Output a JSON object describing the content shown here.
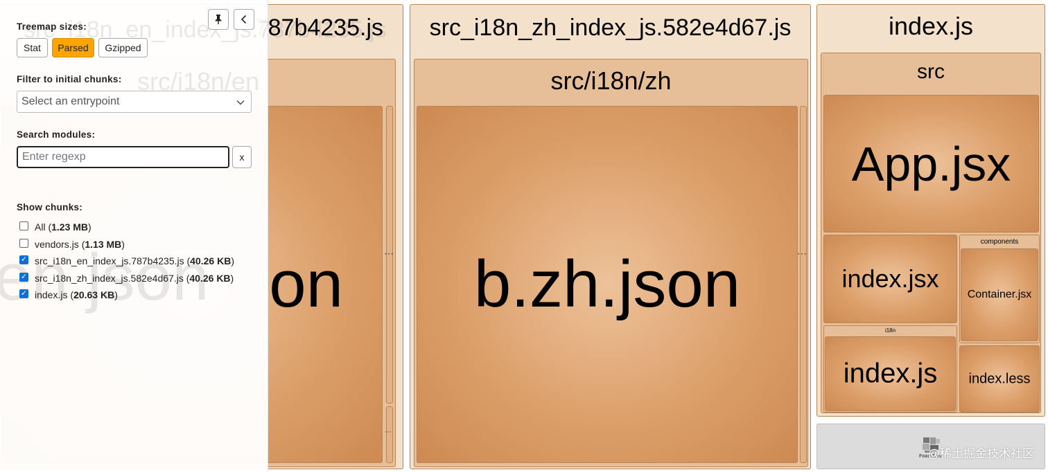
{
  "treemap": {
    "en_chunk": {
      "title": "src_i18n_en_index_js.787b4235.js",
      "title_visible": "787b4235.js",
      "folder": "src/i18n/en",
      "file": "en.json",
      "file_visible": "on"
    },
    "zh_chunk": {
      "title": "src_i18n_zh_index_js.582e4d67.js",
      "folder": "src/i18n/zh",
      "file": "b.zh.json"
    },
    "index_chunk": {
      "title": "index.js",
      "folder": "src",
      "app": "App.jsx",
      "index_jsx": "index.jsx",
      "components_folder": "components",
      "container": "Container.jsx",
      "i18n_folder": "i18n",
      "i18n_index": "index.js",
      "index_less": "index.less"
    },
    "dots": "⋯",
    "watermark": "@稀土掘金技术社区",
    "logo_caption": "FoamTree"
  },
  "sidebar": {
    "treemap_sizes_label": "Treemap sizes:",
    "size_buttons": [
      "Stat",
      "Parsed",
      "Gzipped"
    ],
    "active_size": "Parsed",
    "filter_label": "Filter to initial chunks:",
    "filter_placeholder": "Select an entrypoint",
    "search_label": "Search modules:",
    "search_placeholder": "Enter regexp",
    "clear_button": "x",
    "show_chunks_label": "Show chunks:",
    "chunks": [
      {
        "name": "All",
        "size": "1.23 MB",
        "checked": false
      },
      {
        "name": "vendors.js",
        "size": "1.13 MB",
        "checked": false
      },
      {
        "name": "src_i18n_en_index_js.787b4235.js",
        "size": "40.26 KB",
        "checked": true
      },
      {
        "name": "src_i18n_zh_index_js.582e4d67.js",
        "size": "40.26 KB",
        "checked": true
      },
      {
        "name": "index.js",
        "size": "20.63 KB",
        "checked": true
      }
    ],
    "pin_icon": "pin-icon",
    "collapse_icon": "chevron-left-icon"
  },
  "colors": {
    "accent": "#ffa500",
    "tile": "#dc9f6a",
    "checkbox": "#0b6fd6"
  }
}
